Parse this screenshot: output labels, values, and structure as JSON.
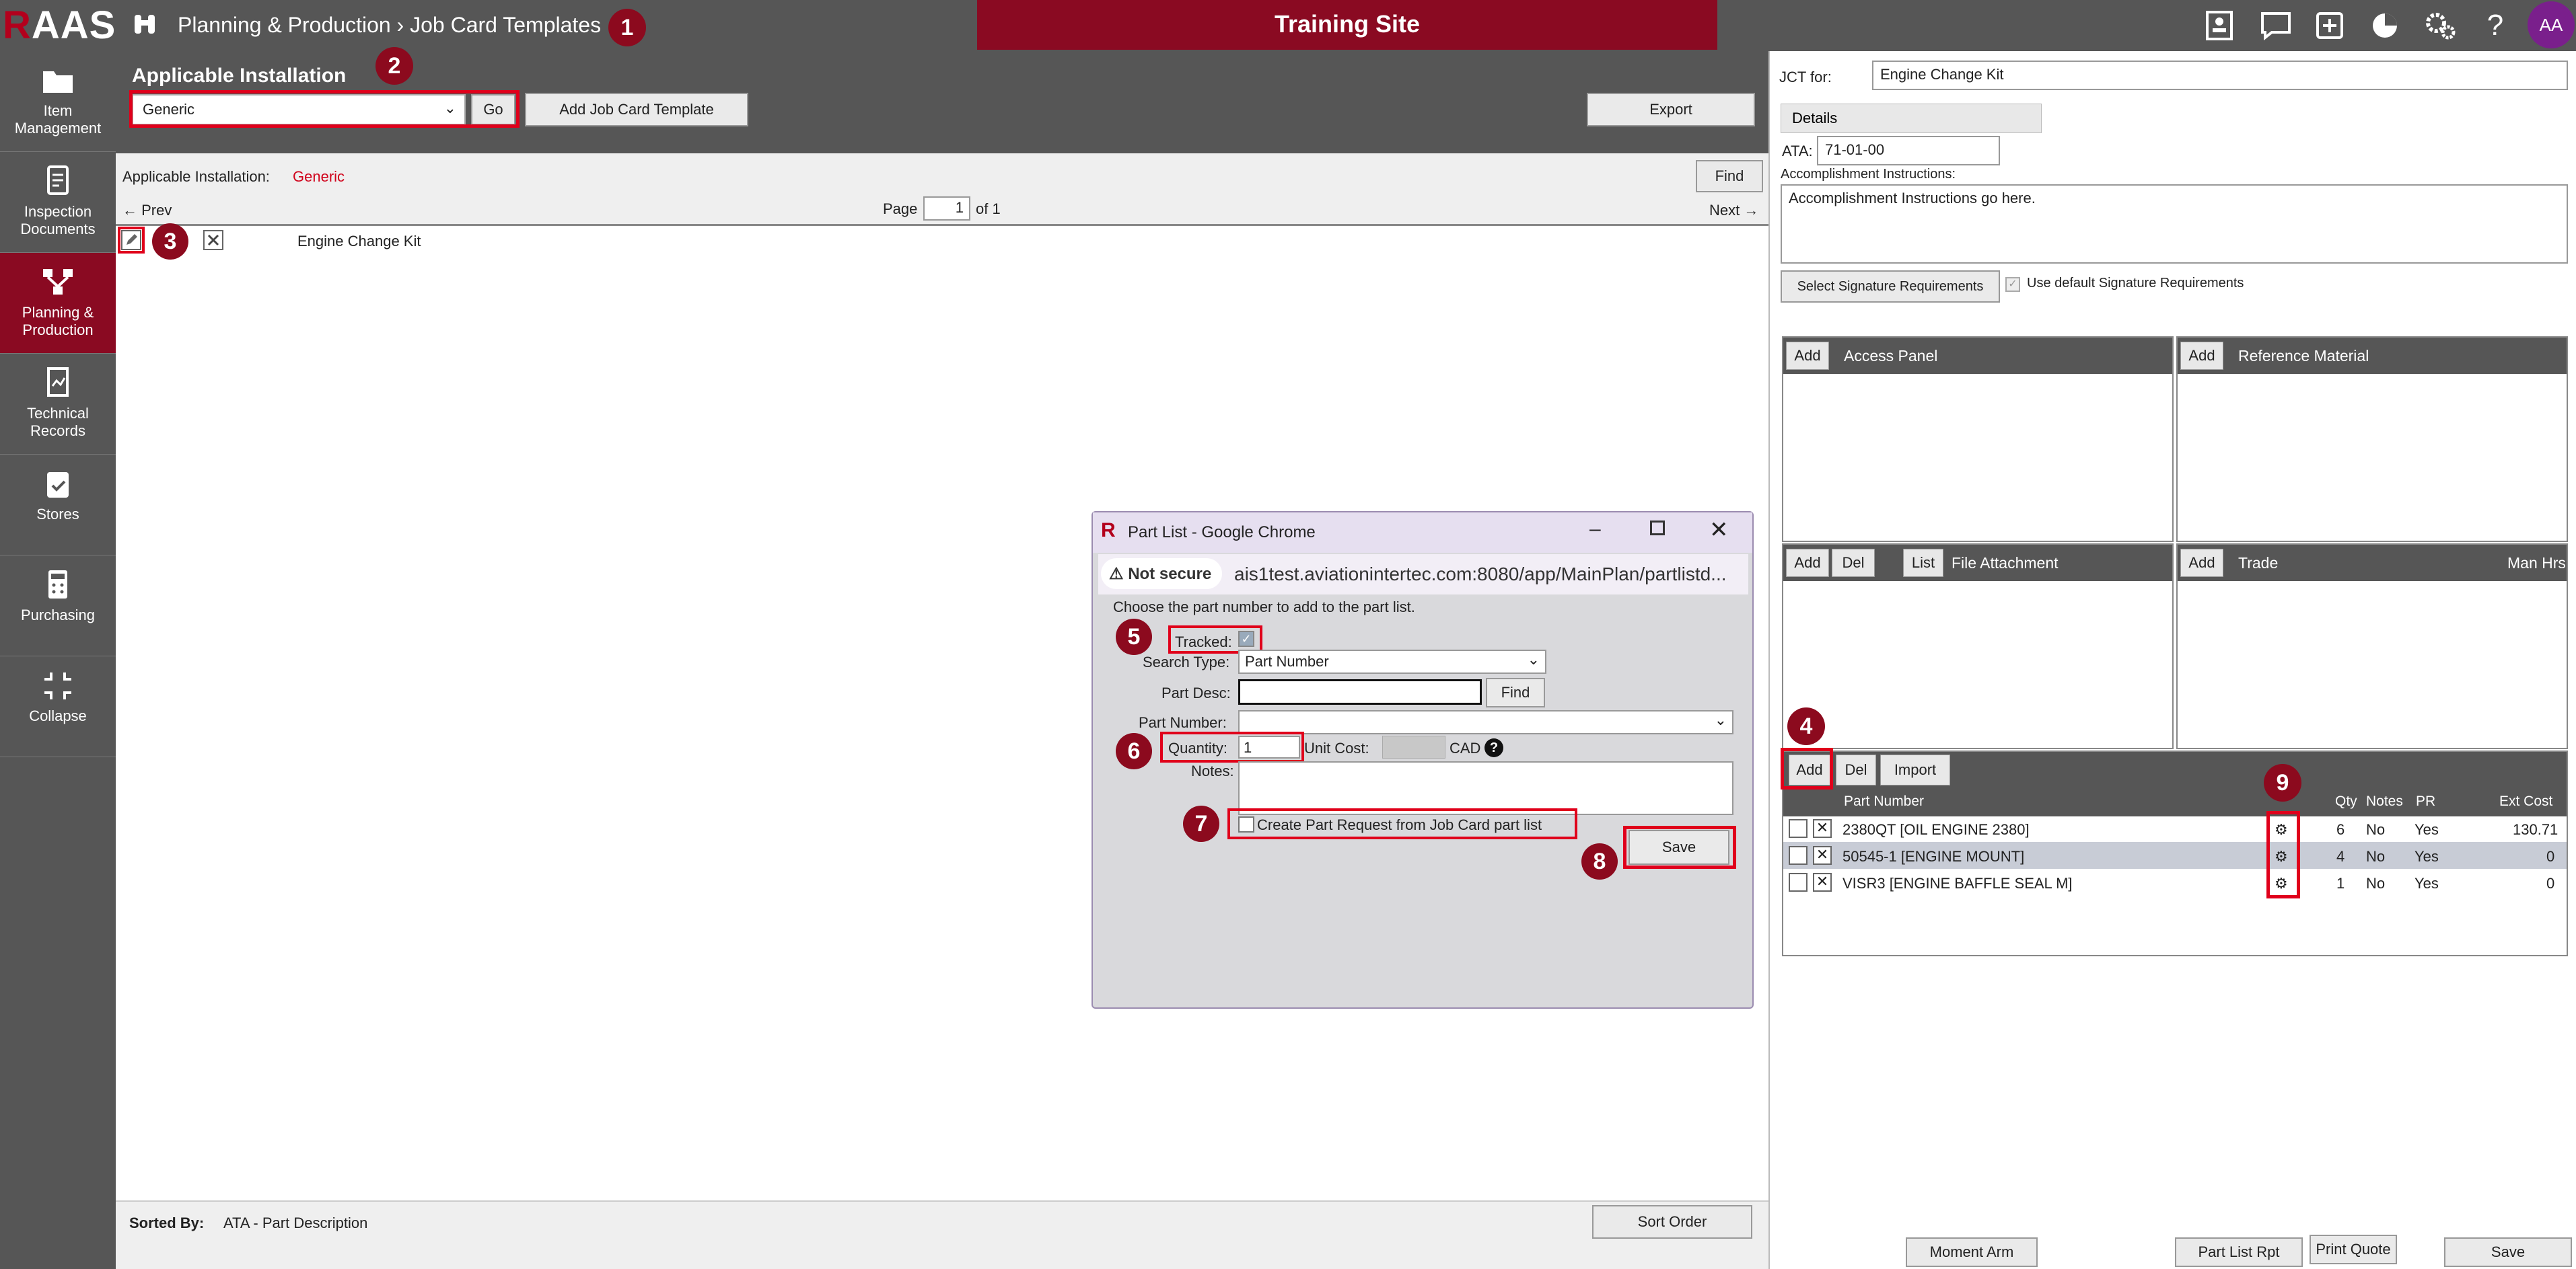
{
  "app": {
    "logo": "AAS",
    "logo_r": "R",
    "breadcrumb": "Planning & Production › Job Card Templates",
    "banner": "Training Site",
    "avatar": "AA"
  },
  "colors": {
    "brand": "#8a0a22",
    "dark": "#565656",
    "marker": "#8c0a1e",
    "highlight": "#e0001b"
  },
  "markers": [
    "1",
    "2",
    "3",
    "4",
    "5",
    "6",
    "7",
    "8",
    "9"
  ],
  "sidebar": {
    "items": [
      {
        "label": "Item Management",
        "icon": "folder-icon"
      },
      {
        "label": "Inspection Documents",
        "icon": "document-icon"
      },
      {
        "label": "Planning & Production",
        "icon": "workflow-icon"
      },
      {
        "label": "Technical Records",
        "icon": "records-icon"
      },
      {
        "label": "Stores",
        "icon": "clipboard-icon"
      },
      {
        "label": "Purchasing",
        "icon": "calculator-icon"
      },
      {
        "label": "Collapse",
        "icon": "collapse-icon"
      }
    ]
  },
  "main": {
    "title": "Applicable Installation",
    "installation_select": "Generic",
    "go": "Go",
    "add_template": "Add Job Card Template",
    "export": "Export",
    "applicable_label": "Applicable Installation:",
    "applicable_value": "Generic",
    "find": "Find",
    "prev": "← Prev",
    "next": "Next →",
    "page_label": "Page",
    "page_value": "1",
    "page_of": "of 1",
    "template_name": "Engine Change Kit",
    "sorted_by_label": "Sorted By:",
    "sorted_by_value": "ATA - Part Description",
    "sort_order": "Sort Order"
  },
  "right": {
    "jct_label": "JCT for:",
    "jct_value": "Engine Change Kit",
    "details_tab": "Details",
    "ata_label": "ATA:",
    "ata_value": "71-01-00",
    "accomplishment_label": "Accomplishment Instructions:",
    "accomplishment_value": "Accomplishment Instructions go here.",
    "select_sig": "Select Signature Requirements",
    "use_default_sig": "Use default Signature Requirements",
    "add": "Add",
    "del": "Del",
    "list": "List",
    "import": "Import",
    "access_panel": "Access Panel",
    "reference_material": "Reference Material",
    "file_attachment": "File Attachment",
    "trade": "Trade",
    "man_hrs": "Man Hrs",
    "parts_headers": {
      "part_number": "Part Number",
      "qty": "Qty",
      "notes": "Notes",
      "pr": "PR",
      "ext_cost": "Ext Cost"
    },
    "parts": [
      {
        "part": "2380QT [OIL ENGINE 2380]",
        "qty": "6",
        "notes": "No",
        "pr": "Yes",
        "ext": "130.71"
      },
      {
        "part": "50545-1 [ENGINE MOUNT]",
        "qty": "4",
        "notes": "No",
        "pr": "Yes",
        "ext": "0"
      },
      {
        "part": "VISR3 [ENGINE BAFFLE SEAL M]",
        "qty": "1",
        "notes": "No",
        "pr": "Yes",
        "ext": "0"
      }
    ],
    "bottom_buttons": [
      "Moment Arm",
      "Part List Rpt",
      "Print Quote",
      "Save"
    ]
  },
  "popup": {
    "window_title": "Part List - Google Chrome",
    "not_secure": "Not secure",
    "url": "ais1test.aviationintertec.com:8080/app/MainPlan/partlistd...",
    "instruction": "Choose the part number to add to the part list.",
    "tracked_label": "Tracked:",
    "search_type_label": "Search Type:",
    "search_type_value": "Part Number",
    "part_desc_label": "Part Desc:",
    "find": "Find",
    "part_number_label": "Part Number:",
    "quantity_label": "Quantity:",
    "quantity_value": "1",
    "unit_cost_label": "Unit Cost:",
    "currency": "CAD",
    "notes_label": "Notes:",
    "create_pr_label": "Create Part Request from Job Card part list",
    "save": "Save"
  }
}
